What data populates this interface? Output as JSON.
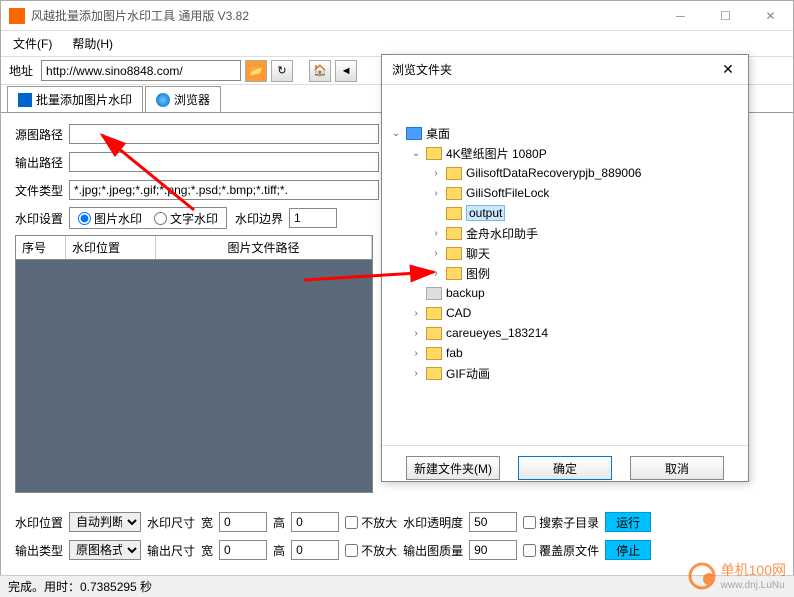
{
  "window": {
    "title": "风越批量添加图片水印工具 通用版 V3.82"
  },
  "menu": {
    "file": "文件(F)",
    "help": "帮助(H)"
  },
  "toolbar": {
    "addr_label": "地址",
    "addr_value": "http://www.sino8848.com/"
  },
  "tabs": {
    "tab1": "批量添加图片水印",
    "tab2": "浏览器"
  },
  "form": {
    "source_path_label": "源图路径",
    "output_path_label": "输出路径",
    "file_type_label": "文件类型",
    "file_type_value": "*.jpg;*.jpeg;*.gif;*.png;*.psd;*.bmp;*.tiff;*.",
    "watermark_label": "水印设置",
    "radio_image": "图片水印",
    "radio_text": "文字水印",
    "border_label": "水印边界",
    "border_value": "1"
  },
  "table": {
    "col1": "序号",
    "col2": "水印位置",
    "col3": "图片文件路径"
  },
  "bottom": {
    "wm_pos_label": "水印位置",
    "wm_pos_value": "自动判断",
    "wm_size_label": "水印尺寸",
    "out_type_label": "输出类型",
    "out_type_value": "原图格式",
    "out_size_label": "输出尺寸",
    "width_label": "宽",
    "height_label": "高",
    "width_value": "0",
    "height_value": "0",
    "no_enlarge": "不放大",
    "opacity_label": "水印透明度",
    "opacity_value": "50",
    "quality_label": "输出图质量",
    "quality_value": "90",
    "search_subdir": "搜索子目录",
    "overwrite": "覆盖原文件",
    "run": "运行",
    "stop": "停止"
  },
  "dialog": {
    "title": "浏览文件夹",
    "new_folder": "新建文件夹(M)",
    "ok": "确定",
    "cancel": "取消",
    "tree": {
      "desktop": "桌面",
      "wallpaper": "4K壁纸图片 1080P",
      "gilisoft1": "GilisoftDataRecoverypjb_889006",
      "gilisoft2": "GiliSoftFileLock",
      "output": "output",
      "jinzhou": "金舟水印助手",
      "chat": "聊天",
      "tuli": "图例",
      "backup": "backup",
      "cad": "CAD",
      "careueyes": "careueyes_183214",
      "fab": "fab",
      "gif": "GIF动画"
    }
  },
  "status": {
    "text": "完成。用时：0.7385295 秒"
  },
  "logo": {
    "text": "单机100网",
    "sub": "www.dnj.LuNu"
  }
}
